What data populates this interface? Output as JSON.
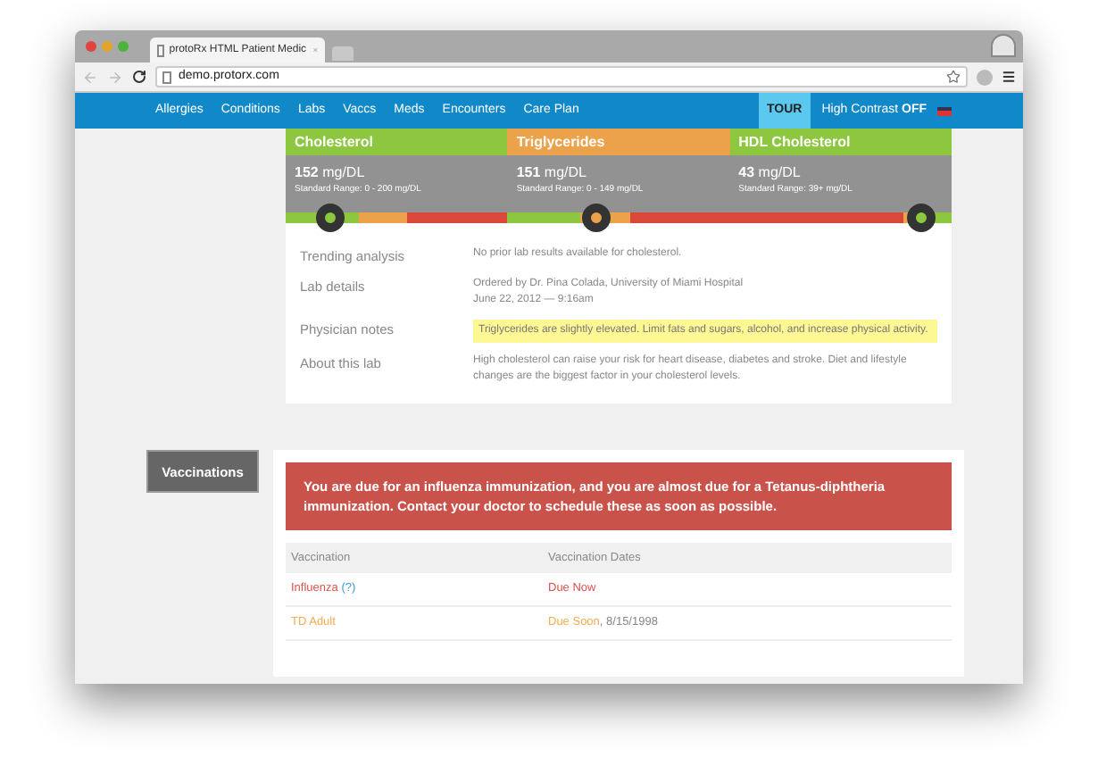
{
  "browser": {
    "tab_title": "protoRx HTML Patient Medic",
    "url": "demo.protorx.com"
  },
  "nav": {
    "items": [
      "Allergies",
      "Conditions",
      "Labs",
      "Vaccs",
      "Meds",
      "Encounters",
      "Care Plan"
    ],
    "tour": "TOUR",
    "high_contrast": {
      "label": "High Contrast",
      "state": "OFF"
    }
  },
  "labs": [
    {
      "name": "Cholesterol",
      "color": "#8dc63f",
      "value": "152",
      "unit": "mg/DL",
      "range": "Standard Range: 0 - 200 mg/DL",
      "kind": "lower_better",
      "level": 0.2
    },
    {
      "name": "Triglycerides",
      "color": "#eba24a",
      "value": "151",
      "unit": "mg/DL",
      "range": "Standard Range: 0 - 149 mg/DL",
      "kind": "lower_better",
      "level": 0.4
    },
    {
      "name": "HDL Cholesterol",
      "color": "#8dc63f",
      "value": "43",
      "unit": "mg/DL",
      "range": "Standard Range: 39+ mg/DL",
      "kind": "higher_better",
      "level": 0.86
    }
  ],
  "details": [
    {
      "label": "Trending analysis",
      "kind": "plain",
      "lines": [
        "No prior lab results available for cholesterol."
      ]
    },
    {
      "label": "Lab details",
      "kind": "plain",
      "lines": [
        "Ordered by Dr. Pina Colada, University of Miami Hospital",
        "June 22, 2012 — 9:16am"
      ]
    },
    {
      "label": "Physician notes",
      "kind": "highlight",
      "lines": [
        "Triglycerides are slightly elevated. Limit fats and sugars, alcohol, and increase physical activity."
      ]
    },
    {
      "label": "About this lab",
      "kind": "plain",
      "lines": [
        "High cholesterol can raise your risk for heart disease, diabetes and stroke. Diet and lifestyle changes are the biggest factor in your cholesterol levels."
      ]
    }
  ],
  "vaccinations": {
    "section": "Vaccinations",
    "alert": "You are due for an influenza immunization, and you are almost due for a Tetanus-diphtheria immunization. Contact your doctor to schedule these as soon as possible.",
    "columns": [
      "Vaccination",
      "Vaccination Dates"
    ],
    "rows": [
      {
        "name": "Influenza",
        "info": "(?)",
        "color": "#d9534f",
        "date_status": "Due Now"
      },
      {
        "name": "TD Adult",
        "color": "#f0ad4e",
        "date_status": "Due Soon",
        "date": ", 8/15/1998"
      }
    ]
  }
}
